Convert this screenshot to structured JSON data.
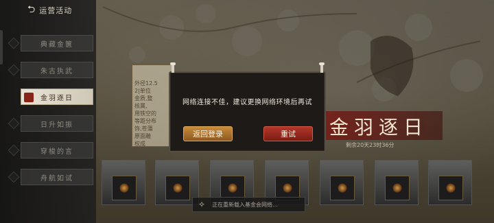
{
  "header": {
    "back_label": "运营活动"
  },
  "sidebar": {
    "items": [
      {
        "label": "典藏金箧",
        "active": false
      },
      {
        "label": "朱古执武",
        "active": false
      },
      {
        "label": "金羽逐日",
        "active": true
      },
      {
        "label": "日升如振",
        "active": false
      },
      {
        "label": "穿梭的言",
        "active": false
      },
      {
        "label": "舟航如试",
        "active": false
      }
    ]
  },
  "event": {
    "panel_text": "外径12.5\n2|单位\n金质,整\n核属,\n用铁空的\n等距分布\n饰,苍蒲\n原面雕\n权成",
    "banner_title": "金羽逐日",
    "banner_sub": "剩余20天23时36分"
  },
  "modal": {
    "message": "网络连接不佳，建议更换网络环境后再试",
    "back_button": "返回登录",
    "retry_button": "重试"
  },
  "loading": {
    "text": "正在重新载入基金会网络..."
  },
  "colors": {
    "accent_gold": "#c98a3a",
    "accent_red": "#b3362a",
    "modal_bg": "#1d1a17"
  }
}
